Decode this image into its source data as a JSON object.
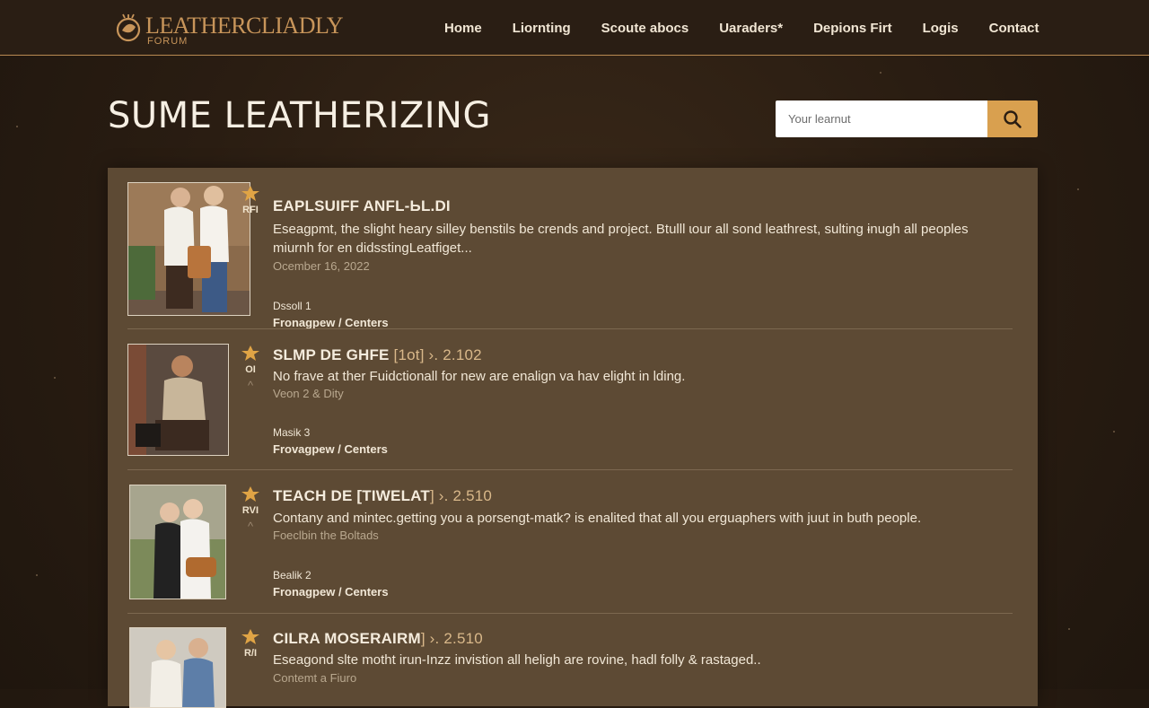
{
  "brand": {
    "title": "LEATHERCLIADLY",
    "subtitle": "FORUM"
  },
  "nav": [
    {
      "label": "Home"
    },
    {
      "label": "Liornting"
    },
    {
      "label": "Scoute abocs"
    },
    {
      "label": "Uaraders*"
    },
    {
      "label": "Depions Firt"
    },
    {
      "label": "Logis"
    },
    {
      "label": "Contact"
    }
  ],
  "page": {
    "title": "SUME LEATHERIZING"
  },
  "search": {
    "placeholder": "Your learnut",
    "icon": "search-icon"
  },
  "colors": {
    "accent": "#d9a04f",
    "panel": "#5d4a34",
    "background": "#2b1e13"
  },
  "posts": [
    {
      "title": "EAPLSUIFF ANFL-ЬL.DI",
      "title_tail": "",
      "badge": "RFI",
      "description": "Eseagpmt, the slight heary silley benstils be crends and project. Btulll ɩour all sond leathrest, sulting ɨnugh all peoples miurnh for en didsstingLeatfiget...",
      "date": "Ocember 16, 2022",
      "meta": "Dssoll 1",
      "category": "Fronagpew / Centers"
    },
    {
      "title": "SLMP DE GHFE",
      "title_tail": "[1ot] ›. 2.102",
      "badge": "OI",
      "description": "No frave at ther Fuidctionall for new are enalign va hav elight in lding.",
      "date": "Veon 2 & Dity",
      "meta": "Masik 3",
      "category": "Frovagpew / Centers"
    },
    {
      "title": "TEACH DE [TIWELAT",
      "title_tail": "] ›. 2.510",
      "badge": "RVI",
      "description": "Contany and mintec.getting you a porsengt-matk? is enalited that all you erguaphers with juut in buth people.",
      "date": "Foeclbin the Boltads",
      "meta": "Bealik 2",
      "category": "Fronagpew / Centers"
    },
    {
      "title": "CILRA MOSERAIRM",
      "title_tail": "] ›. 2.510",
      "badge": "R/I",
      "description": "Eseagond slte motht irun-Inzz invistion all heligh are rovine, hadl folly & rastaged..",
      "date": "Contemt a Fiuro",
      "meta": "",
      "category": ""
    }
  ]
}
